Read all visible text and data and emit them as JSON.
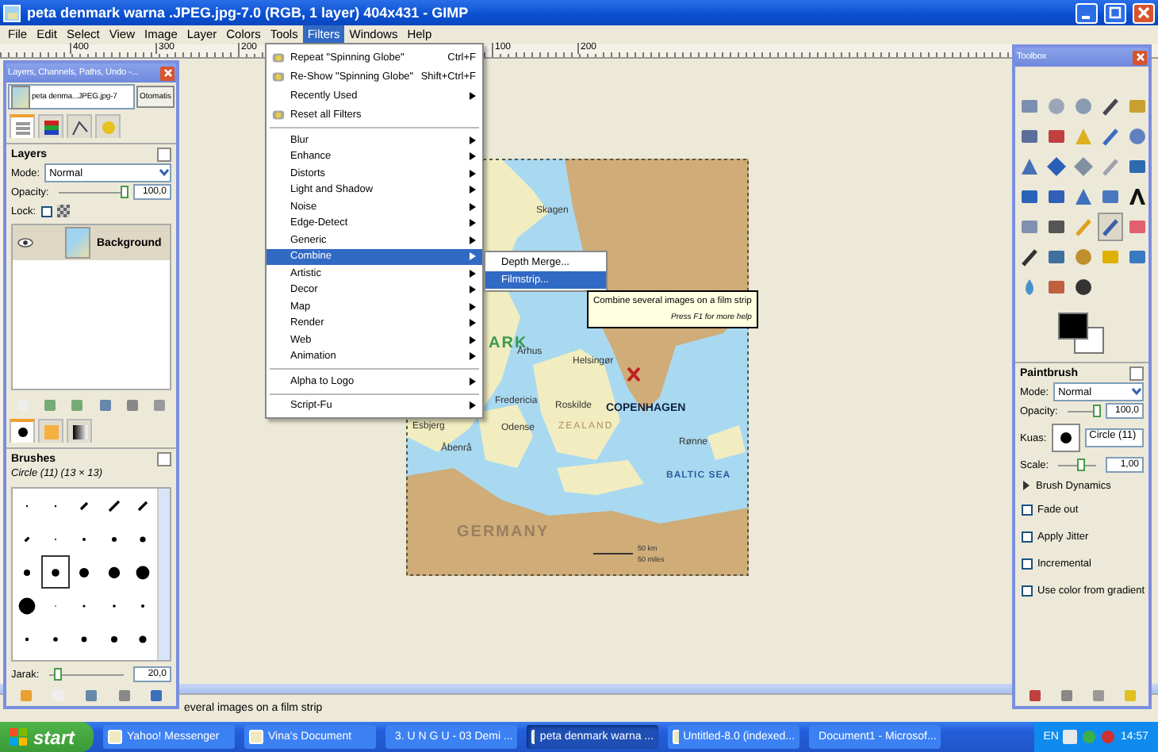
{
  "window": {
    "title": "peta denmark warna .JPEG.jpg-7.0 (RGB, 1 layer) 404x431 - GIMP"
  },
  "menubar": [
    {
      "label": "File",
      "selected": false
    },
    {
      "label": "Edit",
      "selected": false
    },
    {
      "label": "Select",
      "selected": false
    },
    {
      "label": "View",
      "selected": false
    },
    {
      "label": "Image",
      "selected": false
    },
    {
      "label": "Layer",
      "selected": false
    },
    {
      "label": "Colors",
      "selected": false
    },
    {
      "label": "Tools",
      "selected": false
    },
    {
      "label": "Filters",
      "selected": true
    },
    {
      "label": "Windows",
      "selected": false
    },
    {
      "label": "Help",
      "selected": false
    }
  ],
  "ruler": [
    "400",
    "300",
    "200",
    "100",
    "200"
  ],
  "filters_menu": {
    "groups": [
      [
        {
          "label": "Repeat \"Spinning Globe\"",
          "shortcut": "Ctrl+F",
          "has_icon": true,
          "submenu": false,
          "selected": false
        },
        {
          "label": "Re-Show \"Spinning Globe\"",
          "shortcut": "Shift+Ctrl+F",
          "has_icon": true,
          "submenu": false,
          "selected": false
        },
        {
          "label": "Recently Used",
          "has_icon": false,
          "submenu": true,
          "selected": false
        },
        {
          "label": "Reset all Filters",
          "has_icon": true,
          "submenu": false,
          "selected": false
        }
      ],
      [
        {
          "label": "Blur",
          "has_icon": false,
          "submenu": true,
          "selected": false
        },
        {
          "label": "Enhance",
          "has_icon": false,
          "submenu": true,
          "selected": false
        },
        {
          "label": "Distorts",
          "has_icon": false,
          "submenu": true,
          "selected": false
        },
        {
          "label": "Light and Shadow",
          "has_icon": false,
          "submenu": true,
          "selected": false
        },
        {
          "label": "Noise",
          "has_icon": false,
          "submenu": true,
          "selected": false
        },
        {
          "label": "Edge-Detect",
          "has_icon": false,
          "submenu": true,
          "selected": false
        },
        {
          "label": "Generic",
          "has_icon": false,
          "submenu": true,
          "selected": false
        },
        {
          "label": "Combine",
          "has_icon": false,
          "submenu": true,
          "selected": true
        },
        {
          "label": "Artistic",
          "has_icon": false,
          "submenu": true,
          "selected": false
        },
        {
          "label": "Decor",
          "has_icon": false,
          "submenu": true,
          "selected": false
        },
        {
          "label": "Map",
          "has_icon": false,
          "submenu": true,
          "selected": false
        },
        {
          "label": "Render",
          "has_icon": false,
          "submenu": true,
          "selected": false
        },
        {
          "label": "Web",
          "has_icon": false,
          "submenu": true,
          "selected": false
        },
        {
          "label": "Animation",
          "has_icon": false,
          "submenu": true,
          "selected": false
        }
      ],
      [
        {
          "label": "Alpha to Logo",
          "has_icon": false,
          "submenu": true,
          "selected": false
        }
      ],
      [
        {
          "label": "Script-Fu",
          "has_icon": false,
          "submenu": true,
          "selected": false
        }
      ]
    ]
  },
  "combine_submenu": [
    {
      "label": "Depth Merge...",
      "selected": false
    },
    {
      "label": "Filmstrip...",
      "selected": true
    }
  ],
  "tooltip": {
    "text": "Combine several images on a film strip",
    "hint": "Press F1 for more help"
  },
  "map_labels": [
    {
      "label": "Skagen",
      "kind": "town"
    },
    {
      "label": "ARK",
      "kind": "country"
    },
    {
      "label": "Århus",
      "kind": "town"
    },
    {
      "label": "Helsingør",
      "kind": "town"
    },
    {
      "label": "Fredericia",
      "kind": "town"
    },
    {
      "label": "Esbjerg",
      "kind": "town"
    },
    {
      "label": "Roskilde",
      "kind": "town"
    },
    {
      "label": "COPENHAGEN",
      "kind": "capital"
    },
    {
      "label": "Odense",
      "kind": "town"
    },
    {
      "label": "ZEALAND",
      "kind": "region"
    },
    {
      "label": "Åbenrå",
      "kind": "town"
    },
    {
      "label": "Rønne",
      "kind": "town"
    },
    {
      "label": "BALTIC SEA",
      "kind": "sea"
    },
    {
      "label": "GERMANY",
      "kind": "country"
    },
    {
      "label": "50 km",
      "kind": "scale"
    },
    {
      "label": "50 miles",
      "kind": "scale"
    }
  ],
  "status_bar": "everal images on a film strip",
  "layers_dock": {
    "title": "Layers, Channels, Paths, Undo -...",
    "image_name": "peta denma...JPEG.jpg-7",
    "auto_button": "Otomatis",
    "tabs": [
      {
        "selected": true
      },
      {
        "selected": false
      },
      {
        "selected": false
      },
      {
        "selected": false
      }
    ],
    "panel_title": "Layers",
    "mode_label": "Mode:",
    "mode": "Normal",
    "opacity_label": "Opacity:",
    "opacity": {
      "level": 1,
      "reading": "100,0"
    },
    "lock_label": "Lock:",
    "lock_pixels": {
      "checked": false
    },
    "layers": [
      {
        "name": "Background",
        "visible": true,
        "selected": true
      }
    ],
    "brush_tabs": [
      {
        "selected": true
      },
      {
        "selected": false
      },
      {
        "selected": false
      }
    ],
    "brushes_title": "Brushes",
    "brush_name": "Circle (11) (13 × 13)",
    "brushes": [
      {
        "selected": false
      },
      {
        "selected": false
      },
      {
        "selected": false
      },
      {
        "selected": false
      },
      {
        "selected": false
      },
      {
        "selected": false
      },
      {
        "selected": false
      },
      {
        "selected": false
      },
      {
        "selected": false
      },
      {
        "selected": false
      },
      {
        "selected": false
      },
      {
        "selected": true
      },
      {
        "selected": false
      },
      {
        "selected": false
      },
      {
        "selected": false
      },
      {
        "selected": false
      },
      {
        "selected": false
      },
      {
        "selected": false
      },
      {
        "selected": false
      },
      {
        "selected": false
      },
      {
        "selected": false
      },
      {
        "selected": false
      },
      {
        "selected": false
      },
      {
        "selected": false
      },
      {
        "selected": false
      }
    ],
    "spacing_label": "Jarak:",
    "spacing": {
      "level": 0.12,
      "reading": "20,0"
    }
  },
  "toolbox": {
    "title": "Toolbox",
    "tools": [
      {
        "selected": false
      },
      {
        "selected": false
      },
      {
        "selected": false
      },
      {
        "selected": false
      },
      {
        "selected": false
      },
      {
        "selected": false
      },
      {
        "selected": false
      },
      {
        "selected": false
      },
      {
        "selected": false
      },
      {
        "selected": false
      },
      {
        "selected": false
      },
      {
        "selected": false
      },
      {
        "selected": false
      },
      {
        "selected": false
      },
      {
        "selected": false
      },
      {
        "selected": false
      },
      {
        "selected": false
      },
      {
        "selected": false
      },
      {
        "selected": false
      },
      {
        "selected": false
      },
      {
        "selected": false
      },
      {
        "selected": false
      },
      {
        "selected": false
      },
      {
        "selected": true
      },
      {
        "selected": false
      },
      {
        "selected": false
      },
      {
        "selected": false
      },
      {
        "selected": false
      },
      {
        "selected": false
      },
      {
        "selected": false
      },
      {
        "selected": false
      },
      {
        "selected": false
      },
      {
        "selected": false
      }
    ],
    "options_title": "Paintbrush",
    "mode_label": "Mode:",
    "mode": "Normal",
    "opacity_label": "Opacity:",
    "opacity": {
      "level": 1,
      "reading": "100,0"
    },
    "brush_label": "Kuas:",
    "brush": "Circle (11)",
    "scale_label": "Scale:",
    "scale": {
      "level": 0.62,
      "reading": "1,00"
    },
    "dynamics": {
      "label": "Brush Dynamics",
      "expanded": false
    },
    "options": [
      {
        "label": "Fade out",
        "checked": false
      },
      {
        "label": "Apply Jitter",
        "checked": false
      },
      {
        "label": "Incremental",
        "checked": false
      },
      {
        "label": "Use color from gradient",
        "checked": false
      }
    ]
  },
  "taskbar": {
    "start": "start",
    "tasks": [
      {
        "label": "Yahoo! Messenger",
        "selected": false
      },
      {
        "label": "Vina's Document",
        "selected": false
      },
      {
        "label": "3. U N G U - 03 Demi ...",
        "selected": false
      },
      {
        "label": "peta denmark warna ...",
        "selected": true
      },
      {
        "label": "Untitled-8.0 (indexed...",
        "selected": false
      },
      {
        "label": "Document1 - Microsof...",
        "selected": false
      }
    ],
    "language": "EN",
    "clock": "14:57"
  }
}
